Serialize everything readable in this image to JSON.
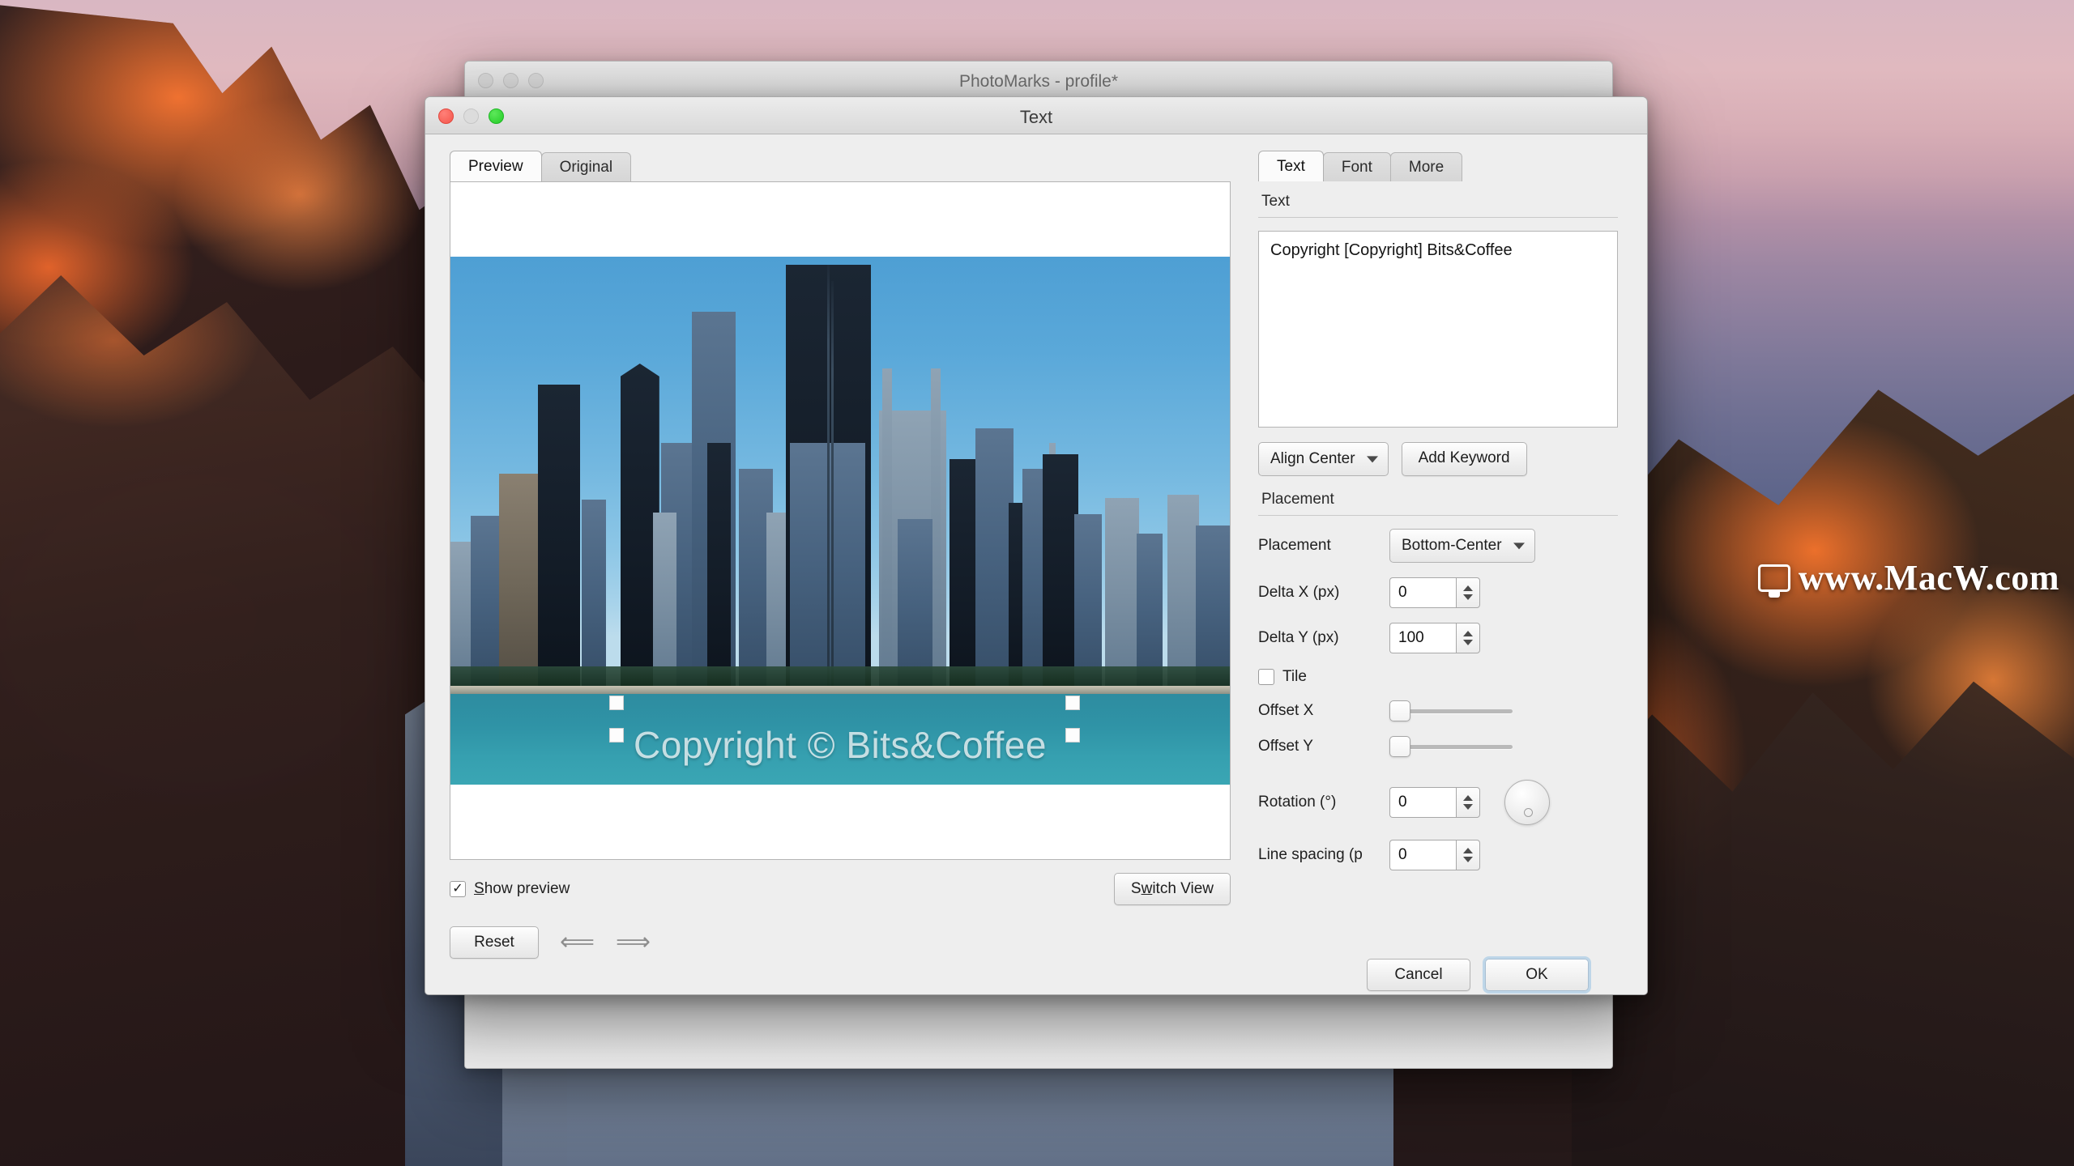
{
  "desktop": {
    "watermark": {
      "text": "www.MacW.com",
      "icon": "monitor-icon"
    }
  },
  "background_window": {
    "title": "PhotoMarks - profile*",
    "traffic_lights": [
      "close",
      "minimize",
      "zoom"
    ]
  },
  "dialog": {
    "title": "Text",
    "traffic_lights": [
      "close",
      "minimize",
      "zoom"
    ],
    "left_pane": {
      "tabs": [
        {
          "label": "Preview",
          "active": true
        },
        {
          "label": "Original",
          "active": false
        }
      ],
      "preview": {
        "watermark_text": "Copyright © Bits&Coffee",
        "image_description": "Chicago skyline over lake"
      },
      "show_preview": {
        "label": "Show preview",
        "checked": true,
        "mnemonic": "S"
      },
      "switch_view_label": "Switch View",
      "reset_label": "Reset",
      "undo_icon": "undo-arrow-icon",
      "redo_icon": "redo-arrow-icon"
    },
    "right_pane": {
      "tabs": [
        {
          "label": "Text",
          "active": true
        },
        {
          "label": "Font",
          "active": false
        },
        {
          "label": "More",
          "active": false
        }
      ],
      "text_section": {
        "heading": "Text",
        "value": "Copyright [Copyright] Bits&Coffee",
        "align_select": "Align Center",
        "add_keyword_label": "Add Keyword"
      },
      "placement_section": {
        "heading": "Placement",
        "placement_label": "Placement",
        "placement_value": "Bottom-Center",
        "delta_x_label": "Delta X (px)",
        "delta_x_value": "0",
        "delta_y_label": "Delta Y (px)",
        "delta_y_value": "100",
        "tile_label": "Tile",
        "tile_checked": false,
        "offset_x_label": "Offset X",
        "offset_x_value": 0,
        "offset_y_label": "Offset Y",
        "offset_y_value": 0,
        "rotation_label": "Rotation (°)",
        "rotation_value": "0",
        "line_spacing_label": "Line spacing (p",
        "line_spacing_value": "0"
      }
    },
    "footer": {
      "cancel_label": "Cancel",
      "ok_label": "OK"
    }
  },
  "colors": {
    "accent_focus_ring": "#82b9e1",
    "dialog_bg": "#eeeeee",
    "titlebar_top": "#ececec",
    "watermark_white": "#ffffff"
  }
}
